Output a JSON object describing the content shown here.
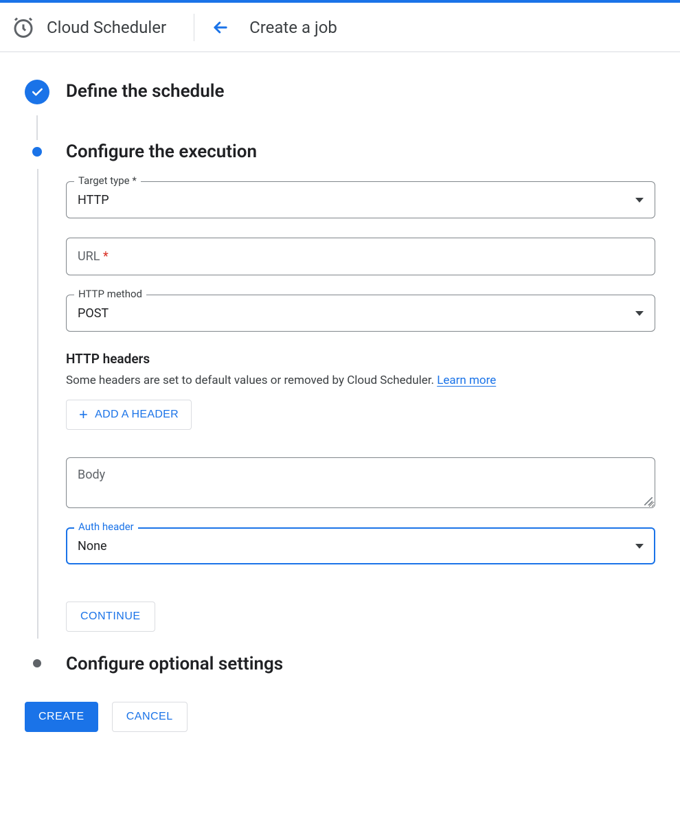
{
  "header": {
    "product": "Cloud Scheduler",
    "page_title": "Create a job"
  },
  "steps": {
    "define": "Define the schedule",
    "execution": "Configure the execution",
    "optional": "Configure optional settings"
  },
  "form": {
    "target_type": {
      "label": "Target type *",
      "value": "HTTP"
    },
    "url": {
      "label": "URL",
      "required_mark": "*"
    },
    "http_method": {
      "label": "HTTP method",
      "value": "POST"
    },
    "headers": {
      "title": "HTTP headers",
      "desc": "Some headers are set to default values or removed by Cloud Scheduler. ",
      "learn_more": "Learn more",
      "add_button": "ADD A HEADER"
    },
    "body": {
      "placeholder": "Body"
    },
    "auth": {
      "label": "Auth header",
      "value": "None"
    },
    "continue": "CONTINUE"
  },
  "footer": {
    "create": "CREATE",
    "cancel": "CANCEL"
  }
}
